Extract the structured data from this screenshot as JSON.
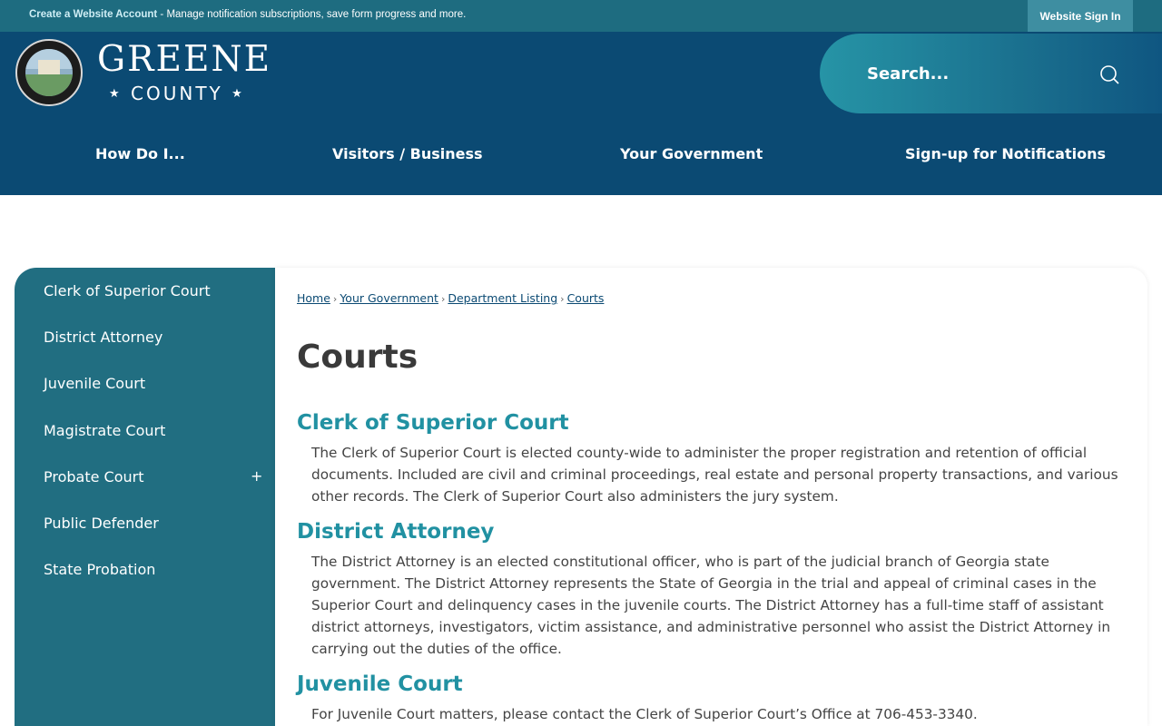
{
  "topbar": {
    "create_account_link": "Create a Website Account",
    "message": " - Manage notification subscriptions, save form progress and more.",
    "signin_label": "Website Sign In"
  },
  "header": {
    "logo_line1": "GREENE",
    "logo_line2": "COUNTY",
    "search_placeholder": "Search..."
  },
  "nav": {
    "items": [
      "How Do I...",
      "Visitors / Business",
      "Your Government",
      "Sign-up for Notifications"
    ]
  },
  "sidebar": {
    "items": [
      "Clerk of Superior Court",
      "District Attorney",
      "Juvenile Court",
      "Magistrate Court",
      "Probate Court",
      "Public Defender",
      "State Probation"
    ],
    "expand_symbol": "+"
  },
  "breadcrumb": [
    "Home",
    "Your Government",
    "Department Listing",
    "Courts"
  ],
  "page_title": "Courts",
  "sections": [
    {
      "title": "Clerk of Superior Court",
      "text": "The Clerk of Superior Court is elected county-wide to administer the proper registration and retention of official documents. Included are civil and criminal proceedings, real estate and personal property transactions, and various other records. The Clerk of Superior Court also administers the jury system."
    },
    {
      "title": "District Attorney",
      "text": "The District Attorney is an elected constitutional officer, who is part of the judicial branch of Georgia state government. The District Attorney represents the State of Georgia in the trial and appeal of criminal cases in the Superior Court and delinquency cases in the juvenile courts. The District Attorney has a full-time staff of assistant district attorneys, investigators, victim assistance, and administrative personnel who assist the District Attorney in carrying out the duties of the office."
    },
    {
      "title": "Juvenile Court",
      "text": "For Juvenile Court matters, please contact the Clerk of Superior Court’s Office at 706-453-3340."
    }
  ],
  "colors": {
    "topbar": "#1e6c80",
    "header": "#0b4a73",
    "sidebar": "#216e81",
    "section_title": "#2191a2"
  }
}
